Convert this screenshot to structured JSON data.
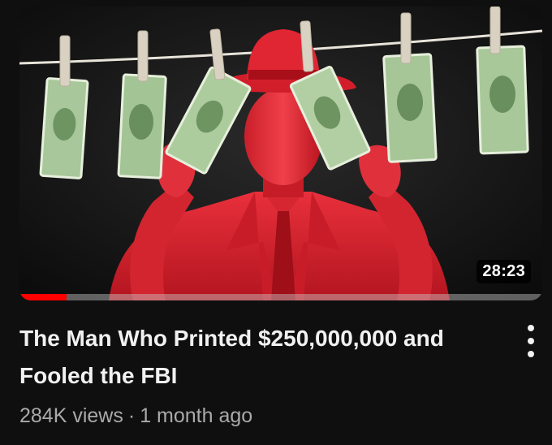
{
  "video": {
    "title": "The Man Who Printed $250,000,000 and Fooled the FBI",
    "duration": "28:23",
    "views": "284K views",
    "separator": "·",
    "published": "1 month ago",
    "watch_progress": 0.09
  },
  "icons": {
    "menu": "more-vert-icon"
  },
  "colors": {
    "background": "#0f0f0f",
    "progress": "#ff0000",
    "title": "#f1f1f1",
    "meta": "#aaaaaa",
    "figure_red": "#e0202f"
  }
}
